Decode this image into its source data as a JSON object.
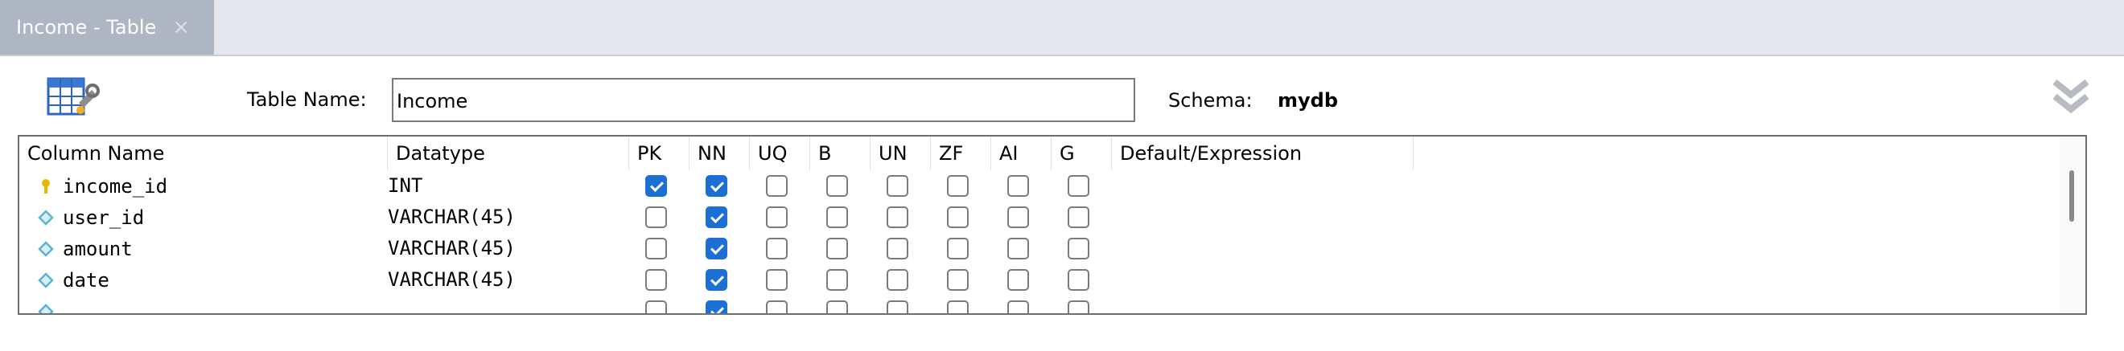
{
  "tab": {
    "label": "Income - Table",
    "close_glyph": "×"
  },
  "header": {
    "table_name_label": "Table Name:",
    "table_name_value": "Income",
    "schema_label": "Schema:",
    "schema_value": "mydb"
  },
  "grid": {
    "columns": [
      "Column Name",
      "Datatype",
      "PK",
      "NN",
      "UQ",
      "B",
      "UN",
      "ZF",
      "AI",
      "G",
      "Default/Expression"
    ],
    "rows": [
      {
        "icon": "primary-key-icon",
        "name": "income_id",
        "datatype": "INT",
        "flags": [
          true,
          true,
          false,
          false,
          false,
          false,
          false,
          false
        ]
      },
      {
        "icon": "column-diamond-icon",
        "name": "user_id",
        "datatype": "VARCHAR(45)",
        "flags": [
          false,
          true,
          false,
          false,
          false,
          false,
          false,
          false
        ]
      },
      {
        "icon": "column-diamond-icon",
        "name": "amount",
        "datatype": "VARCHAR(45)",
        "flags": [
          false,
          true,
          false,
          false,
          false,
          false,
          false,
          false
        ]
      },
      {
        "icon": "column-diamond-icon",
        "name": "date",
        "datatype": "VARCHAR(45)",
        "flags": [
          false,
          true,
          false,
          false,
          false,
          false,
          false,
          false
        ]
      },
      {
        "icon": "column-diamond-icon",
        "name": "",
        "datatype": "",
        "flags": [
          false,
          true,
          false,
          false,
          false,
          false,
          false,
          false
        ]
      }
    ]
  },
  "colors": {
    "accent": "#1c6fd3",
    "tab_bg": "#aeb6c3",
    "key_icon": "#e6b800",
    "diamond_icon": "#5fb3cf"
  }
}
